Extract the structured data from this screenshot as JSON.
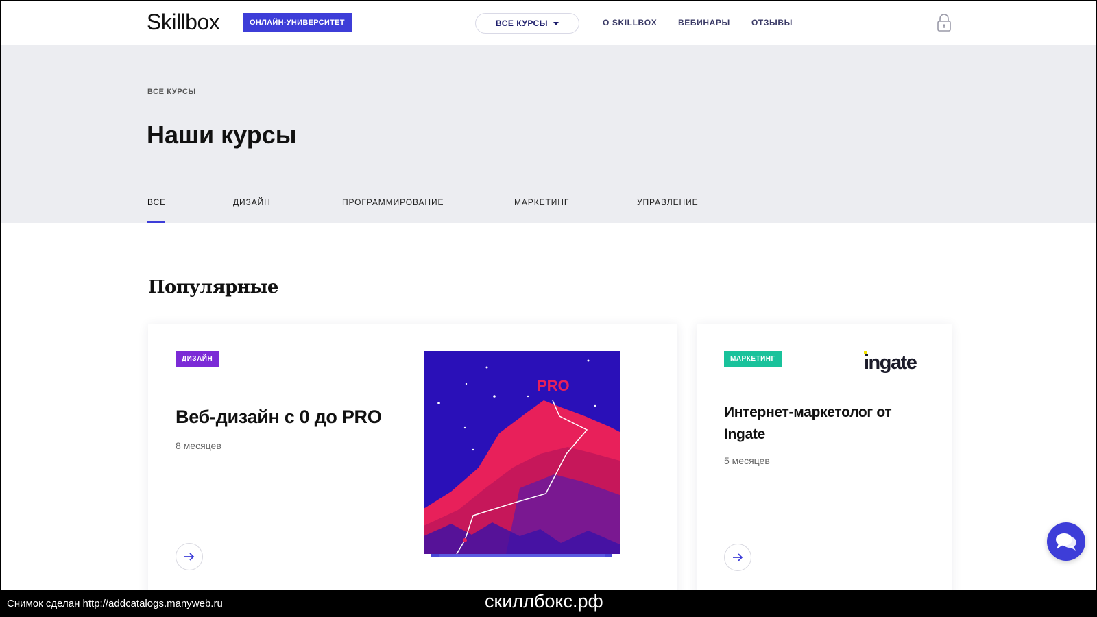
{
  "header": {
    "logo": "Skillbox",
    "badge": "ОНЛАЙН-УНИВЕРСИТЕТ",
    "all_courses": "ВСЕ КУРСЫ",
    "nav": [
      "О SKILLBOX",
      "ВЕБИНАРЫ",
      "ОТЗЫВЫ"
    ],
    "lock_icon": "lock-icon"
  },
  "hero": {
    "breadcrumb": "ВСЕ КУРСЫ",
    "title": "Наши курсы",
    "tabs": [
      "ВСЕ",
      "ДИЗАЙН",
      "ПРОГРАММИРОВАНИЕ",
      "МАРКЕТИНГ",
      "УПРАВЛЕНИЕ"
    ],
    "active_tab": "ВСЕ"
  },
  "section": {
    "title": "Популярные"
  },
  "cards": [
    {
      "tag": "ДИЗАЙН",
      "tag_color": "#7b2bd6",
      "title": "Веб-дизайн с 0 до PRO",
      "duration": "8 месяцев",
      "art_label": "PRO"
    },
    {
      "tag": "МАРКЕТИНГ",
      "tag_color": "#19c29b",
      "title_line1": "Интернет-маркетолог от",
      "title_line2": "Ingate",
      "duration": "5 месяцев",
      "partner_logo": "ingate"
    }
  ],
  "colors": {
    "accent": "#3d3dd8",
    "hero_bg": "#ecedf1"
  },
  "footer": {
    "snapshot": "Снимок сделан http://addcatalogs.manyweb.ru",
    "domain": "скиллбокс.рф"
  }
}
